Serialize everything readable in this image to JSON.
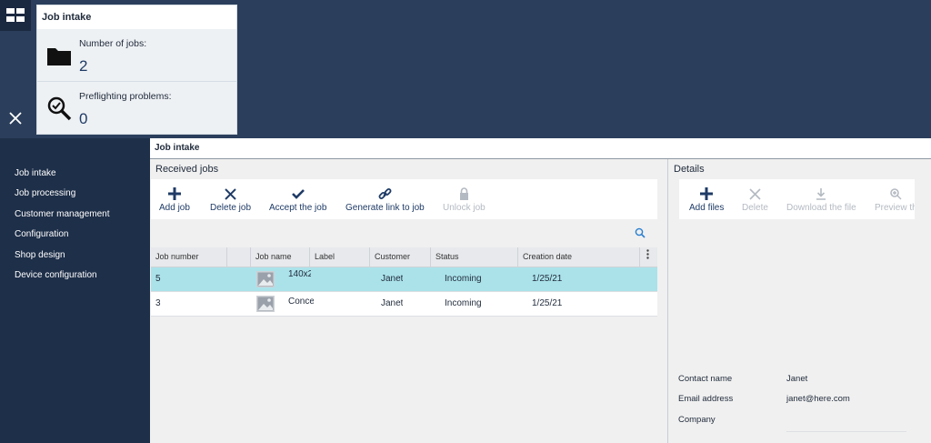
{
  "header": {
    "menu_icon": "grid-icon",
    "close_icon": "close-icon"
  },
  "summary_card": {
    "title": "Job intake",
    "stats": [
      {
        "label": "Number of jobs:",
        "value": "2",
        "icon": "folder-icon"
      },
      {
        "label": "Preflighting problems:",
        "value": "0",
        "icon": "magnifier-check-icon"
      }
    ]
  },
  "sidebar": {
    "items": [
      {
        "label": "Job intake"
      },
      {
        "label": "Job processing"
      },
      {
        "label": "Customer management"
      },
      {
        "label": "Configuration"
      },
      {
        "label": "Shop design"
      },
      {
        "label": "Device configuration"
      }
    ]
  },
  "main": {
    "header": "Job intake",
    "received": {
      "title": "Received jobs",
      "toolbar": {
        "add_job": "Add job",
        "delete_job": "Delete job",
        "accept_job": "Accept the job",
        "generate_link": "Generate link to job",
        "unlock_job": "Unlock job"
      },
      "columns": [
        "Job number",
        "",
        "Job name",
        "Label",
        "Customer",
        "Status",
        "Creation date"
      ],
      "rows": [
        {
          "number": "5",
          "name": "140x2(",
          "label": "",
          "customer": "Janet",
          "status": "Incoming",
          "date": "1/25/21",
          "selected": true
        },
        {
          "number": "3",
          "name": "Conce",
          "label": "",
          "customer": "Janet",
          "status": "Incoming",
          "date": "1/25/21",
          "selected": false
        }
      ]
    },
    "details": {
      "title": "Details",
      "toolbar": {
        "add_files": "Add files",
        "delete": "Delete",
        "download": "Download the file",
        "preview": "Preview th"
      },
      "fields": [
        {
          "label": "Contact name",
          "value": "Janet"
        },
        {
          "label": "Email address",
          "value": "janet@here.com"
        },
        {
          "label": "Company",
          "value": ""
        }
      ]
    }
  },
  "colors": {
    "topbar": "#2b3f5c",
    "sidebar": "#1e2f49",
    "selected_row": "#abe2ea",
    "accent": "#1f3b66"
  }
}
